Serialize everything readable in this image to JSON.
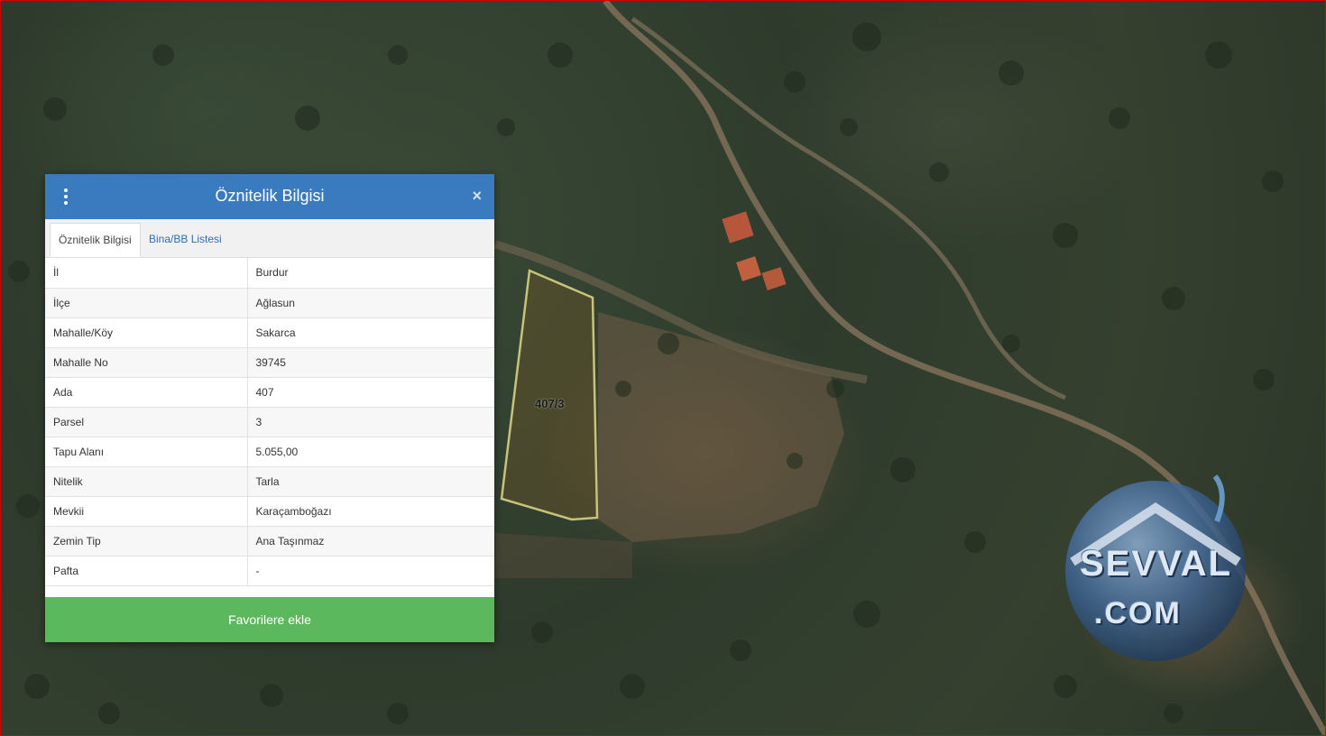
{
  "map": {
    "parcel_label": "407/3",
    "watermark": {
      "line1": "SEVVAL",
      "line2": ".COM"
    }
  },
  "panel": {
    "title": "Öznitelik Bilgisi",
    "close_symbol": "×",
    "tabs": [
      {
        "label": "Öznitelik Bilgisi",
        "active": true
      },
      {
        "label": "Bina/BB Listesi",
        "active": false
      }
    ],
    "rows": [
      {
        "key": "İl",
        "value": "Burdur"
      },
      {
        "key": "İlçe",
        "value": "Ağlasun"
      },
      {
        "key": "Mahalle/Köy",
        "value": "Sakarca"
      },
      {
        "key": "Mahalle No",
        "value": "39745"
      },
      {
        "key": "Ada",
        "value": "407"
      },
      {
        "key": "Parsel",
        "value": "3"
      },
      {
        "key": "Tapu Alanı",
        "value": "5.055,00"
      },
      {
        "key": "Nitelik",
        "value": "Tarla"
      },
      {
        "key": "Mevkii",
        "value": "Karaçamboğazı"
      },
      {
        "key": "Zemin Tip",
        "value": "Ana Taşınmaz"
      },
      {
        "key": "Pafta",
        "value": "-"
      }
    ],
    "favorite_button": "Favorilere ekle"
  },
  "colors": {
    "header": "#3a7bbf",
    "favorite": "#5cb85c",
    "map_border": "#d60000",
    "parcel_outline": "#c9c27a"
  },
  "icons": {
    "menu": "vertical-ellipsis-icon",
    "close": "close-icon"
  }
}
